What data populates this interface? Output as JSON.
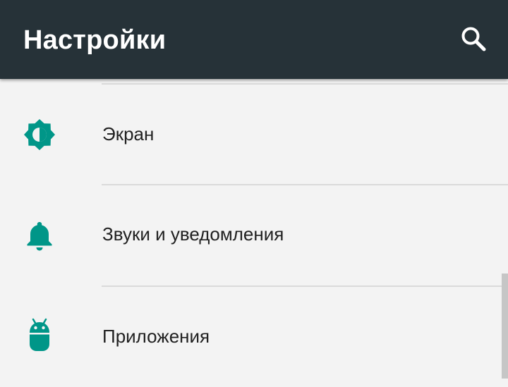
{
  "app_bar": {
    "title": "Настройки",
    "search_icon": "search-icon"
  },
  "settings_items": [
    {
      "label": "Экран",
      "icon": "brightness-icon"
    },
    {
      "label": "Звуки и уведомления",
      "icon": "bell-icon"
    },
    {
      "label": "Приложения",
      "icon": "android-icon"
    }
  ],
  "colors": {
    "app_bar": "#263238",
    "accent": "#009688",
    "background": "#f3f3f3"
  }
}
